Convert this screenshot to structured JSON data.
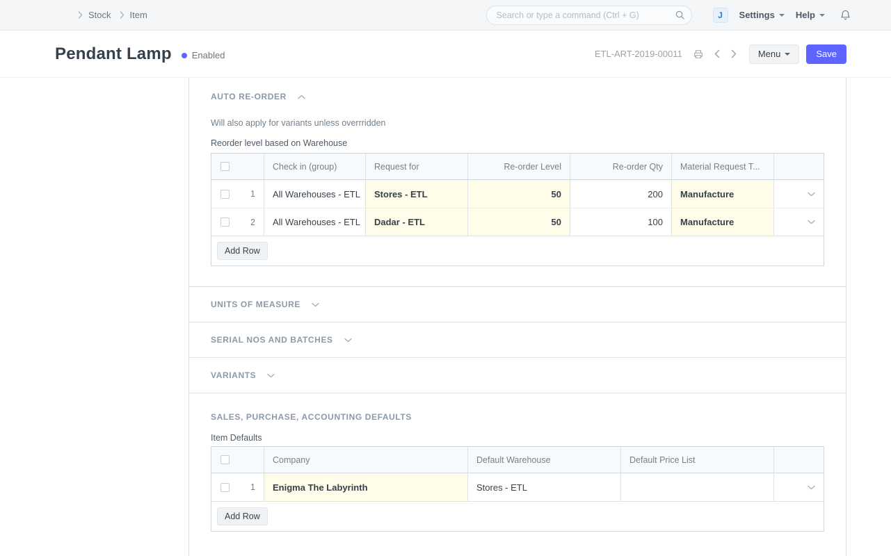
{
  "navbar": {
    "breadcrumb_1": "Stock",
    "breadcrumb_2": "Item",
    "search_placeholder": "Search or type a command (Ctrl + G)",
    "avatar_letter": "J",
    "settings_label": "Settings",
    "help_label": "Help"
  },
  "page_head": {
    "title": "Pendant Lamp",
    "status": "Enabled",
    "doc_id": "ETL-ART-2019-00011",
    "menu_label": "Menu",
    "save_label": "Save"
  },
  "auto_reorder": {
    "heading": "AUTO RE-ORDER",
    "note": "Will also apply for variants unless overrridden",
    "grid_label": "Reorder level based on Warehouse",
    "columns": {
      "check_in": "Check in (group)",
      "request_for": "Request for",
      "level": "Re-order Level",
      "qty": "Re-order Qty",
      "mrt": "Material Request T..."
    },
    "rows": [
      {
        "idx": "1",
        "check_in": "All Warehouses - ETL",
        "request_for": "Stores - ETL",
        "level": "50",
        "qty": "200",
        "mrt": "Manufacture"
      },
      {
        "idx": "2",
        "check_in": "All Warehouses - ETL",
        "request_for": "Dadar - ETL",
        "level": "50",
        "qty": "100",
        "mrt": "Manufacture"
      }
    ],
    "add_row_label": "Add Row"
  },
  "collapsed_sections": [
    {
      "heading": "UNITS OF MEASURE"
    },
    {
      "heading": "SERIAL NOS AND BATCHES"
    },
    {
      "heading": "VARIANTS"
    }
  ],
  "defaults": {
    "heading": "SALES, PURCHASE, ACCOUNTING DEFAULTS",
    "grid_label": "Item Defaults",
    "columns": {
      "company": "Company",
      "warehouse": "Default Warehouse",
      "price_list": "Default Price List"
    },
    "rows": [
      {
        "idx": "1",
        "company": "Enigma The Labyrinth",
        "warehouse": "Stores - ETL",
        "price_list": ""
      }
    ],
    "add_row_label": "Add Row"
  },
  "colors": {
    "primary": "#5e64ff",
    "status_dot": "#5e64ff",
    "editable_cell_bg": "#fffce9",
    "grid_header_bg": "#f7fafc",
    "navbar_bg": "#f5f6f8"
  }
}
